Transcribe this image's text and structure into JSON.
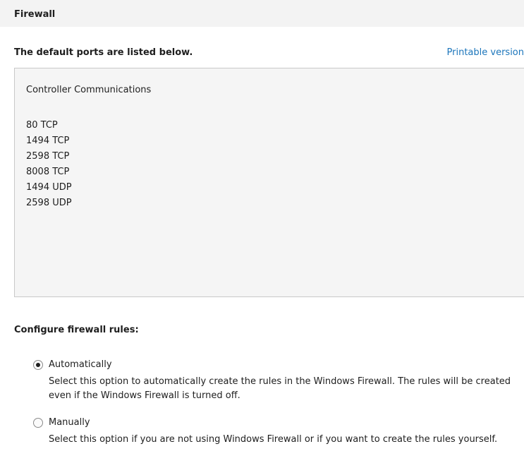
{
  "header": {
    "title": "Firewall"
  },
  "main": {
    "subtitle": "The default ports are listed below.",
    "printable_link": "Printable version",
    "ports_box": {
      "heading": "Controller Communications",
      "ports": [
        "80 TCP",
        "1494 TCP",
        "2598 TCP",
        "8008 TCP",
        "1494 UDP",
        "2598 UDP"
      ]
    },
    "configure_label": "Configure firewall rules:",
    "options": [
      {
        "label": "Automatically",
        "selected": true,
        "description": "Select this option to automatically create the rules in the Windows Firewall.  The rules will be created even if the Windows Firewall is turned off."
      },
      {
        "label": "Manually",
        "selected": false,
        "description": "Select this option if you are not using Windows Firewall or if you want to create the rules yourself."
      }
    ]
  },
  "colors": {
    "link": "#1b75bb",
    "box_background": "#f5f5f5",
    "box_border": "#c8c8c8"
  }
}
